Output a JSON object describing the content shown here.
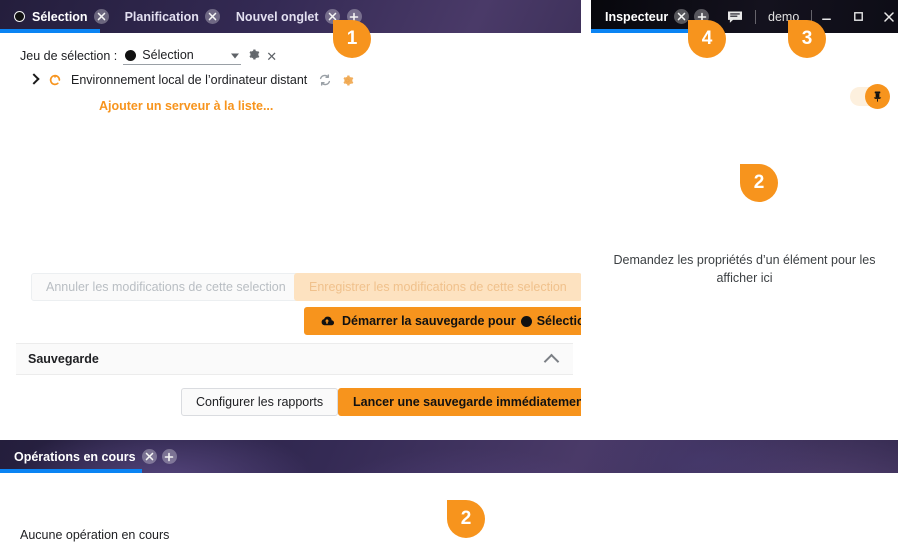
{
  "app": {
    "window_title": "demo",
    "accent_orange": "#f7941d",
    "accent_blue": "#0b84f3"
  },
  "left_panel": {
    "tabs": [
      {
        "label": "Sélection",
        "active": true,
        "has_dot": true,
        "close_icon": "close-icon"
      },
      {
        "label": "Planification",
        "active": false,
        "has_dot": false,
        "close_icon": "close-icon"
      },
      {
        "label": "Nouvel onglet",
        "active": false,
        "has_dot": false,
        "close_icon": "close-icon"
      }
    ],
    "add_tab_icon": "plus-icon",
    "selection_set": {
      "label": "Jeu de sélection :",
      "value": "Sélection",
      "dropdown_icon": "chevron-down-icon",
      "settings_icon": "gear-icon",
      "remove_icon": "close-icon"
    },
    "tree": {
      "expand_icon": "chevron-right-icon",
      "node_icon": "spinner-icon",
      "node_label": "Environnement local de l’ordinateur distant",
      "refresh_icon": "refresh-icon",
      "settings_icon": "gear-icon"
    },
    "add_server_link": "Ajouter un serveur à la liste...",
    "buttons": {
      "cancel_changes": "Annuler les modifications de cette selection",
      "save_changes": "Enregistrer les modifications de cette selection",
      "start_backup": "Démarrer la sauvegarde pour",
      "start_backup_target": "Sélection",
      "start_backup_icon": "cloud-upload-icon"
    },
    "section": {
      "title": "Sauvegarde",
      "collapse_icon": "chevron-up-icon",
      "configure_reports": "Configurer les rapports",
      "run_backup_now": "Lancer une sauvegarde immédiatement"
    }
  },
  "right_panel": {
    "tab_label": "Inspecteur",
    "close_icon": "close-icon",
    "add_tab_icon": "plus-icon",
    "chat_icon": "chat-icon",
    "window_label": "demo",
    "window_controls": {
      "minimize_icon": "minimize-icon",
      "maximize_icon": "maximize-icon",
      "close_icon": "close-icon"
    },
    "pin_toggle_icon": "pin-icon",
    "empty_message": "Demandez les propriétés d’un élément pour les afficher ici"
  },
  "bottom_panel": {
    "tab_label": "Opérations en cours",
    "close_icon": "close-icon",
    "add_tab_icon": "plus-icon",
    "empty_message": "Aucune opération en cours"
  },
  "badges": [
    {
      "number": "1"
    },
    {
      "number": "2"
    },
    {
      "number": "3"
    },
    {
      "number": "4"
    },
    {
      "number": "2"
    }
  ]
}
